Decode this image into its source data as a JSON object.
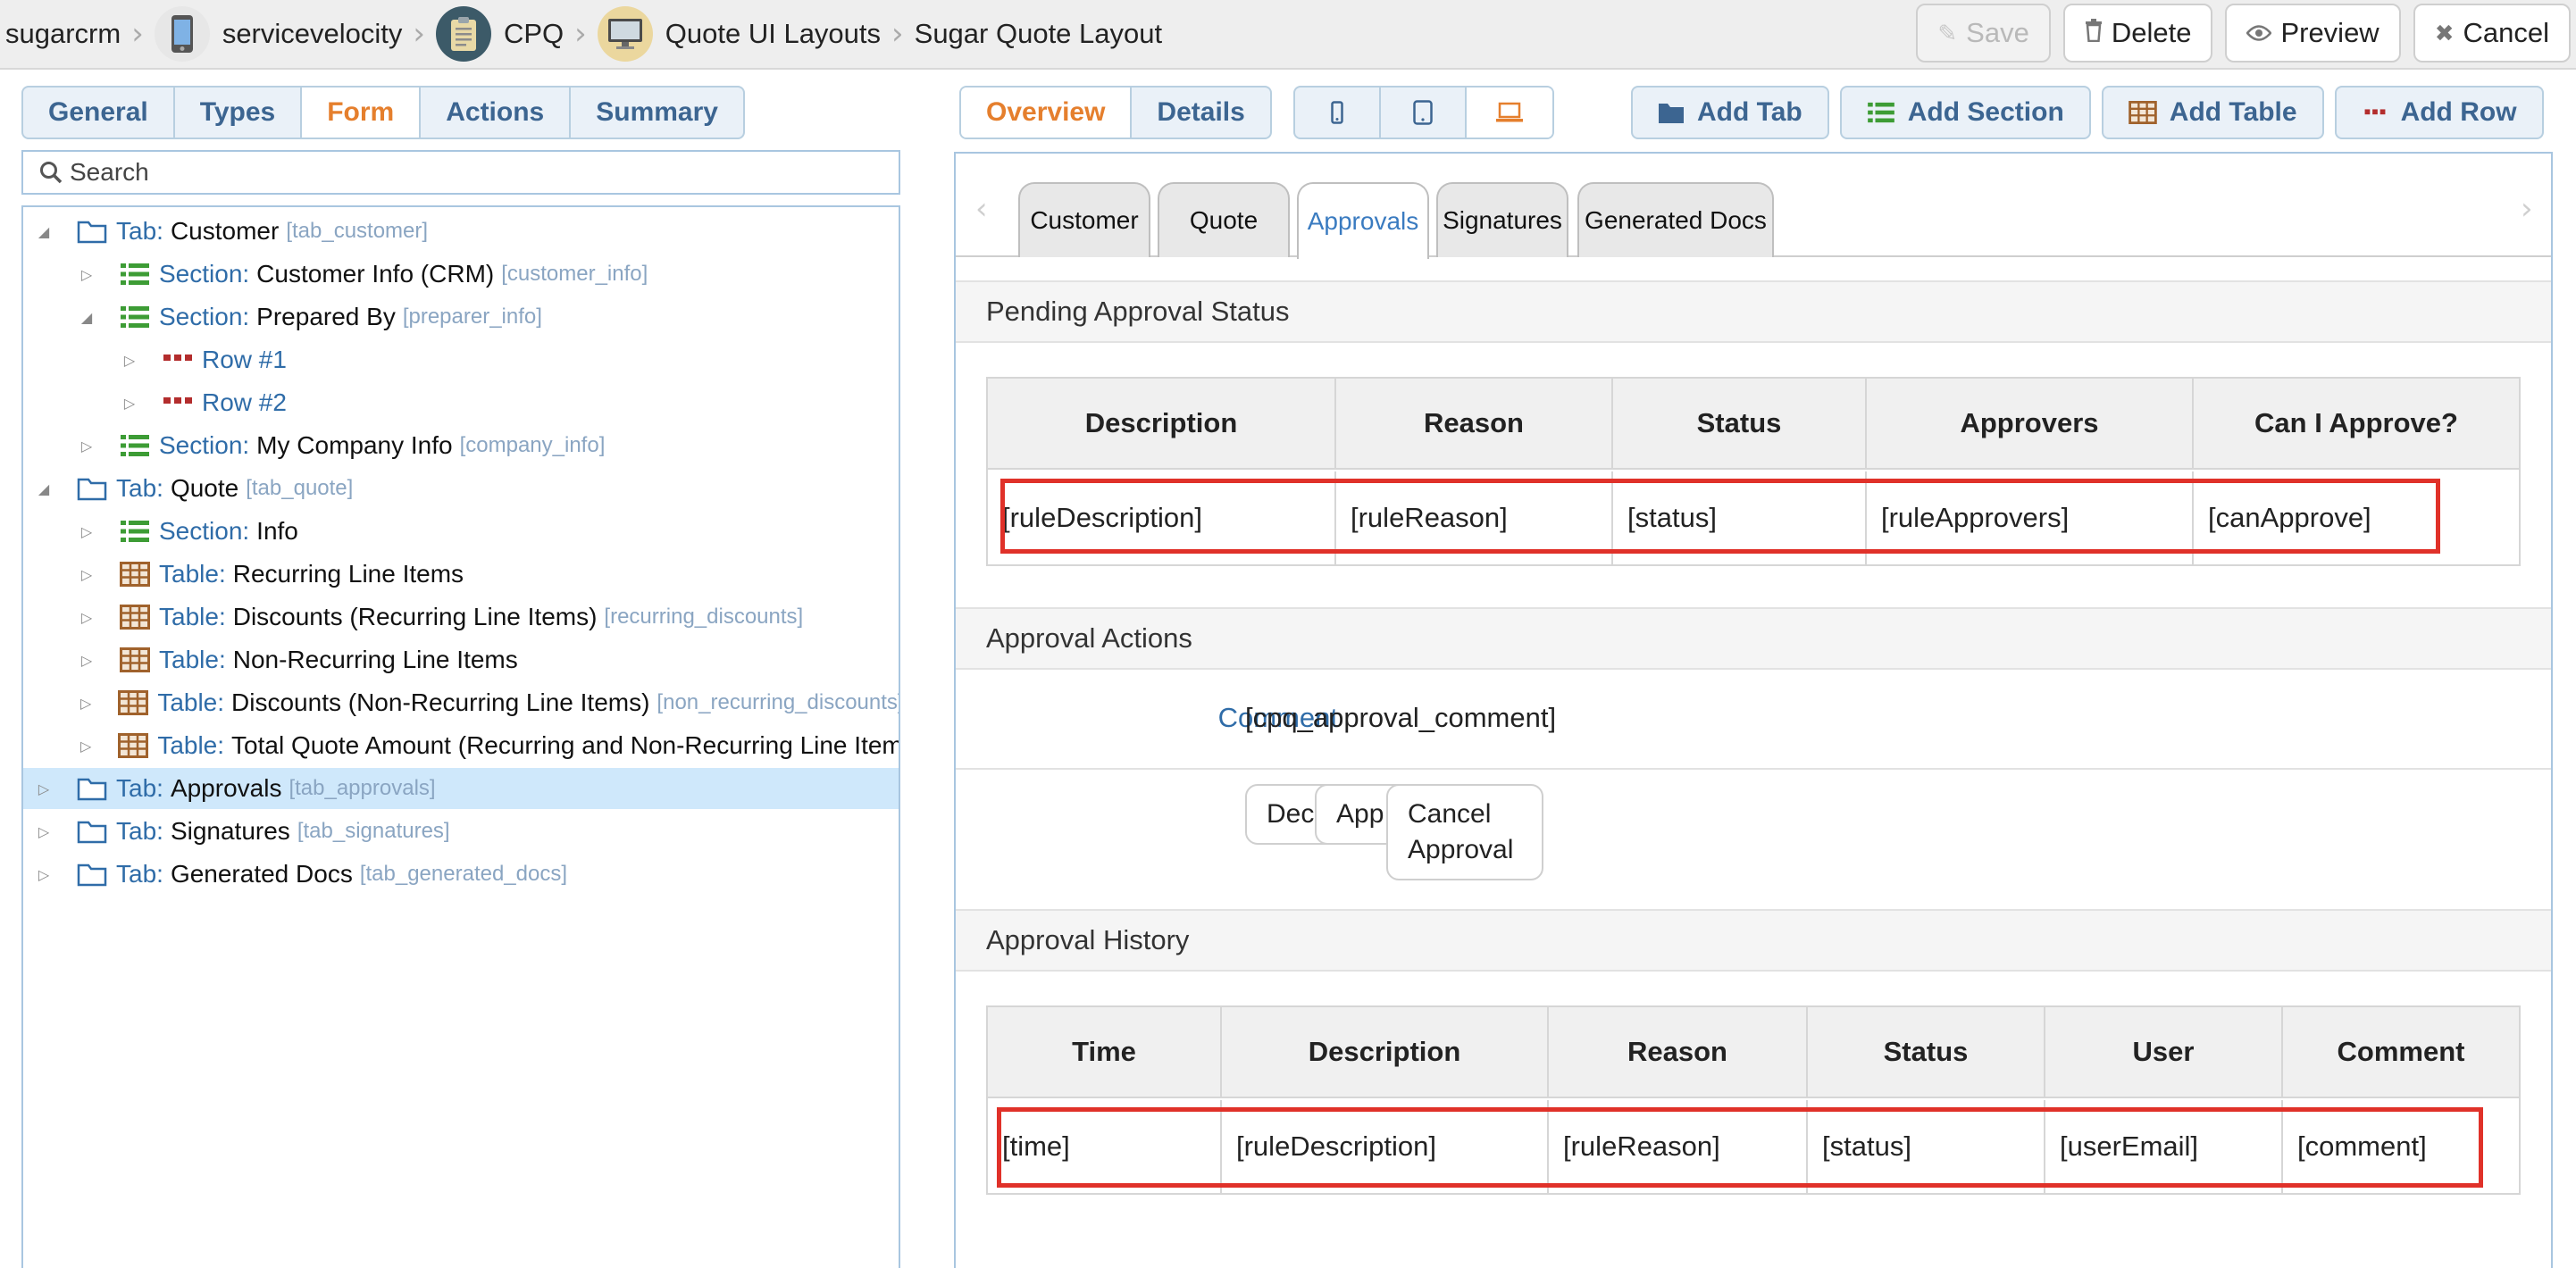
{
  "breadcrumb": [
    "sugarcrm",
    "servicevelocity",
    "CPQ",
    "Quote UI Layouts",
    "Sugar Quote Layout"
  ],
  "toolbar": {
    "save": "Save",
    "delete": "Delete",
    "preview": "Preview",
    "cancel": "Cancel"
  },
  "left_tabs": [
    "General",
    "Types",
    "Form",
    "Actions",
    "Summary"
  ],
  "left_active_tab": "Form",
  "search": {
    "placeholder": "Search"
  },
  "tree": [
    {
      "kind": "Tab:",
      "name": "Customer",
      "key": "[tab_customer]"
    },
    {
      "kind": "Section:",
      "name": "Customer Info (CRM)",
      "key": "[customer_info]"
    },
    {
      "kind": "Section:",
      "name": "Prepared By",
      "key": "[preparer_info]"
    },
    {
      "kind": "",
      "name": "Row #1",
      "key": ""
    },
    {
      "kind": "",
      "name": "Row #2",
      "key": ""
    },
    {
      "kind": "Section:",
      "name": "My Company Info",
      "key": "[company_info]"
    },
    {
      "kind": "Tab:",
      "name": "Quote",
      "key": "[tab_quote]"
    },
    {
      "kind": "Section:",
      "name": "Info",
      "key": ""
    },
    {
      "kind": "Table:",
      "name": "Recurring Line Items",
      "key": ""
    },
    {
      "kind": "Table:",
      "name": "Discounts (Recurring Line Items)",
      "key": "[recurring_discounts]"
    },
    {
      "kind": "Table:",
      "name": "Non-Recurring Line Items",
      "key": ""
    },
    {
      "kind": "Table:",
      "name": "Discounts (Non-Recurring Line Items)",
      "key": "[non_recurring_discounts]"
    },
    {
      "kind": "Table:",
      "name": "Total Quote Amount (Recurring and Non-Recurring Line Items",
      "key": ""
    },
    {
      "kind": "Tab:",
      "name": "Approvals",
      "key": "[tab_approvals]"
    },
    {
      "kind": "Tab:",
      "name": "Signatures",
      "key": "[tab_signatures]"
    },
    {
      "kind": "Tab:",
      "name": "Generated Docs",
      "key": "[tab_generated_docs]"
    }
  ],
  "right_tabs": [
    "Overview",
    "Details"
  ],
  "add_buttons": [
    "Add Tab",
    "Add Section",
    "Add Table",
    "Add Row"
  ],
  "form_tabs": [
    "Customer",
    "Quote",
    "Approvals",
    "Signatures",
    "Generated Docs"
  ],
  "form_active_tab": "Approvals",
  "pending": {
    "title": "Pending Approval Status",
    "headers": [
      "Description",
      "Reason",
      "Status",
      "Approvers",
      "Can I Approve?"
    ],
    "row": [
      "[ruleDescription]",
      "[ruleReason]",
      "[status]",
      "[ruleApprovers]",
      "[canApprove]"
    ]
  },
  "actions": {
    "title": "Approval Actions",
    "comment_label": "Comment",
    "comment_value": "[cpq_approval_comment]",
    "buttons": [
      "Dec",
      "App",
      "Cancel Approval"
    ]
  },
  "history": {
    "title": "Approval History",
    "headers": [
      "Time",
      "Description",
      "Reason",
      "Status",
      "User",
      "Comment"
    ],
    "row": [
      "[time]",
      "[ruleDescription]",
      "[ruleReason]",
      "[status]",
      "[userEmail]",
      "[comment]"
    ]
  },
  "colors": {
    "accent": "#e57f2d",
    "link": "#2f6ca8",
    "highlight": "#e03129",
    "selection": "#cfe8fb"
  }
}
